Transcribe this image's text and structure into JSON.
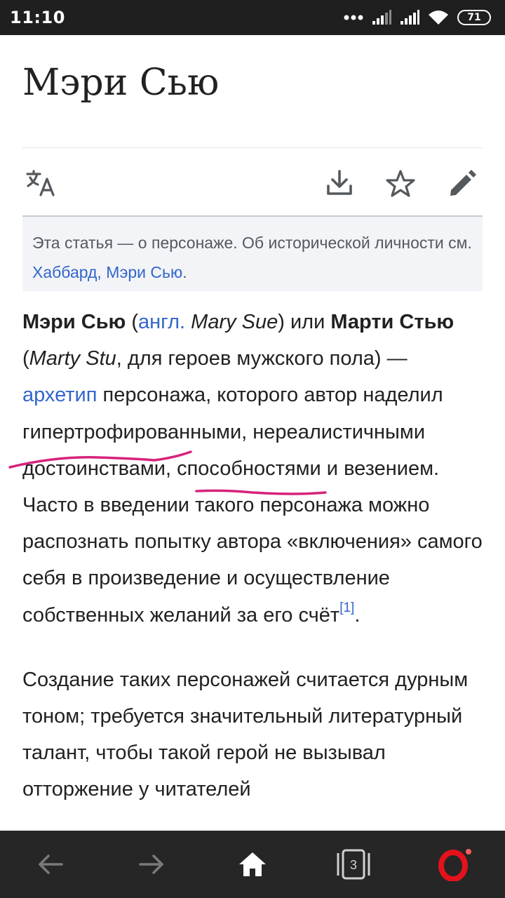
{
  "status_bar": {
    "time": "11:10",
    "battery": "71"
  },
  "article": {
    "title": "Мэри Сью",
    "hatnote": {
      "text": "Эта статья — о персонаже. Об исторической личности см. ",
      "link": "Хаббард, Мэри Сью",
      "end": "."
    },
    "paragraph1": {
      "term1": "Мэри Сью",
      "open_paren": " (",
      "lang_link": "англ.",
      "space": " ",
      "term1_en": "Mary Sue",
      "or_text": ") или ",
      "term2": "Марти Стью",
      "open_paren2": " (",
      "term2_en": "Marty Stu",
      "gender_note": ", для героев мужского пола) — ",
      "archetype_link": "архетип",
      "body": " персонажа, которого автор наделил гипертрофированными, нереалистичными достоинствами, способностями и везением. Часто в введении такого персонажа можно распознать попытку автора «включения» самого себя в произведение и осуществление собственных желаний за его счёт",
      "ref": "[1]",
      "end": "."
    },
    "paragraph2": "Создание таких персонажей считается дурным тоном; требуется значительный литературный талант, чтобы такой герой не вызывал отторжение у читателей"
  },
  "toolbar": {
    "language_icon": "translate-icon",
    "download_icon": "download-icon",
    "star_icon": "star-icon",
    "edit_icon": "pencil-icon"
  },
  "navigation": {
    "tabs_count": "3",
    "back_icon": "arrow-left-icon",
    "forward_icon": "arrow-right-icon",
    "home_icon": "home-icon",
    "opera_icon": "opera-logo-icon"
  },
  "colors": {
    "link": "#3366cc",
    "annotation": "#d6237c",
    "opera_red": "#e3121b"
  }
}
